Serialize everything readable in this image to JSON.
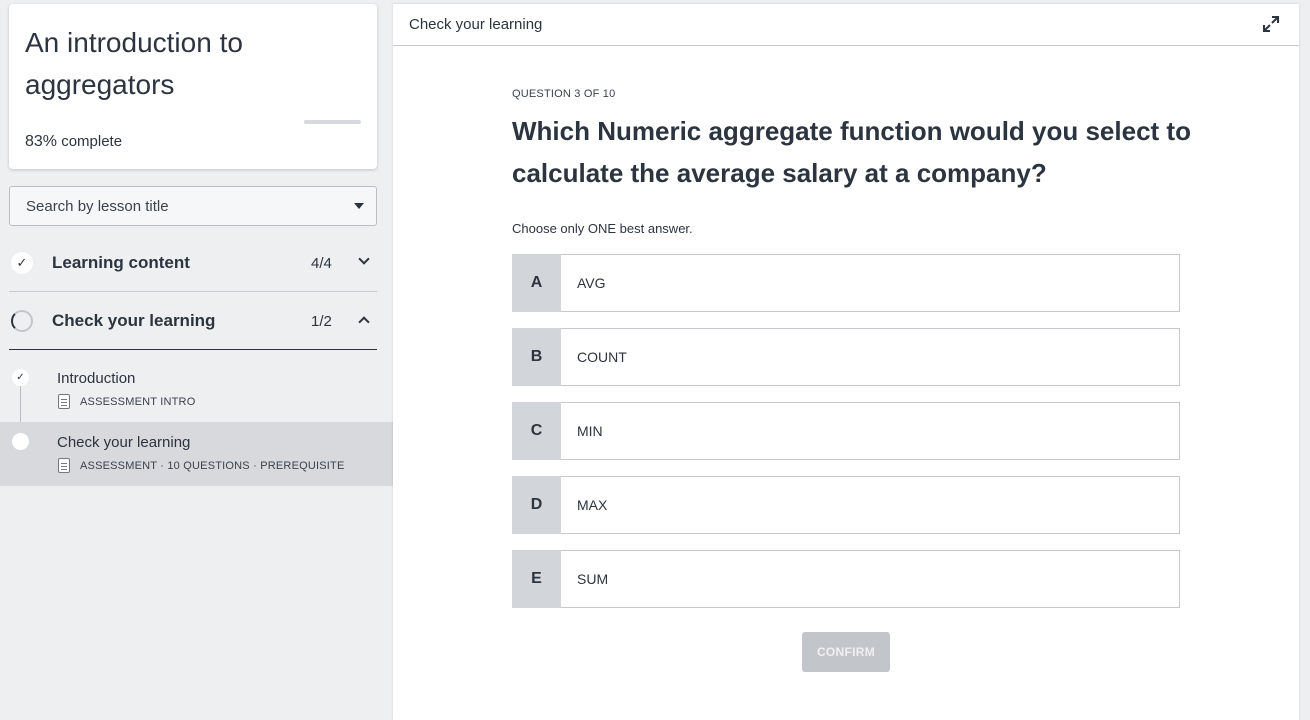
{
  "course": {
    "title": "An introduction to aggregators",
    "percent": "83%",
    "complete_label": "complete",
    "progress_fraction": 0.83
  },
  "search": {
    "placeholder": "Search by lesson title"
  },
  "sections": [
    {
      "label": "Learning content",
      "count": "4/4",
      "state": "collapsed"
    },
    {
      "label": "Check your learning",
      "count": "1/2",
      "state": "expanded"
    }
  ],
  "lessons": [
    {
      "title": "Introduction",
      "meta": "ASSESSMENT INTRO"
    },
    {
      "title": "Check your learning",
      "meta": "ASSESSMENT · 10 QUESTIONS · PREREQUISITE"
    }
  ],
  "main": {
    "header_title": "Check your learning",
    "question_counter": "QUESTION 3 OF 10",
    "question_text": "Which Numeric aggregate function would you select to calculate the average salary at a company?",
    "instruction": "Choose only ONE best answer.",
    "options": [
      {
        "letter": "A",
        "text": "AVG"
      },
      {
        "letter": "B",
        "text": "COUNT"
      },
      {
        "letter": "C",
        "text": "MIN"
      },
      {
        "letter": "D",
        "text": "MAX"
      },
      {
        "letter": "E",
        "text": "SUM"
      }
    ],
    "confirm_label": "CONFIRM"
  },
  "icons": {
    "check": "check-icon",
    "expand": "expand-icon",
    "dropdown": "caret-down-icon",
    "doc": "document-icon"
  },
  "colors": {
    "text": "#2c3440",
    "sidebar_bg": "#eeeff0",
    "active_lesson_bg": "#d7d9dc",
    "option_letter_bg": "#d2d5d9",
    "confirm_disabled_bg": "#c2c6cb"
  }
}
